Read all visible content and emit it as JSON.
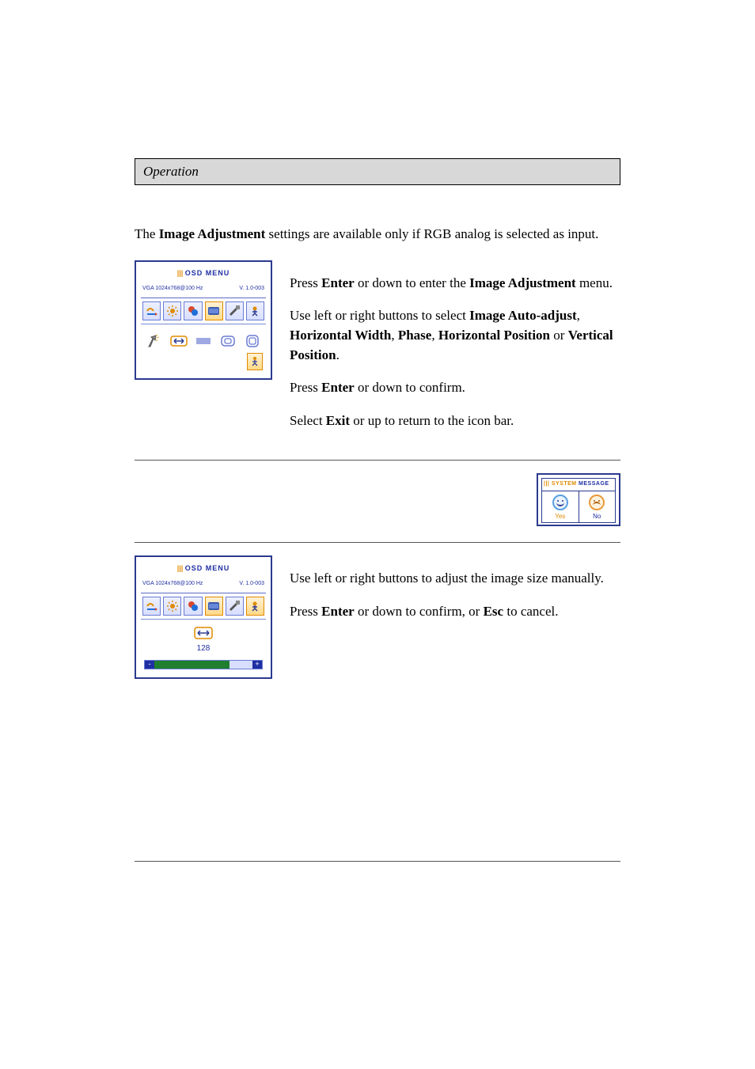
{
  "header": {
    "title": "Operation"
  },
  "intro": {
    "prefix": "The ",
    "bold1": "Image Adjustment",
    "suffix": " settings are available only if RGB analog is selected as input."
  },
  "block1": {
    "p1": {
      "a": "Press ",
      "b": "Enter",
      "c": " or down to enter the ",
      "d": "Image Adjustment",
      "e": " menu."
    },
    "p2": {
      "a": "Use left or right buttons to select ",
      "b": "Image Auto-adjust",
      "c": ", ",
      "d": "Horizontal Width",
      "e": ", ",
      "f": "Phase",
      "g": ", ",
      "h": "Horizontal Position",
      "i": " or ",
      "j": "Vertical Position",
      "k": "."
    },
    "p3": {
      "a": "Press ",
      "b": "Enter",
      "c": " or down to confirm."
    },
    "p4": {
      "a": "Select ",
      "b": "Exit",
      "c": " or up to return to the icon bar."
    }
  },
  "block2": {
    "p1": "Use left or right buttons to adjust the image size manually.",
    "p2": {
      "a": "Press ",
      "b": "Enter",
      "c": " or down to confirm, or ",
      "d": "Esc",
      "e": " to cancel."
    }
  },
  "osd": {
    "titlePrefix": "||| ",
    "title": "OSD MENU",
    "source": "VGA  1024x768@100 Hz",
    "version": "V. 1.0-003",
    "icons": [
      "input-icon",
      "brightness-icon",
      "color-icon",
      "image-adjust-icon",
      "tools-icon",
      "exit-icon"
    ],
    "opts": [
      "auto-adjust-icon",
      "hwidth-icon",
      "phase-icon",
      "hpos-icon",
      "vpos-icon"
    ],
    "slider": {
      "value": "128",
      "percent": 72,
      "minus": "-",
      "plus": "+"
    }
  },
  "sysmsg": {
    "titleA": "||| SYSTEM",
    "titleB": " MESSAGE",
    "yes": "Yes",
    "no": "No"
  }
}
